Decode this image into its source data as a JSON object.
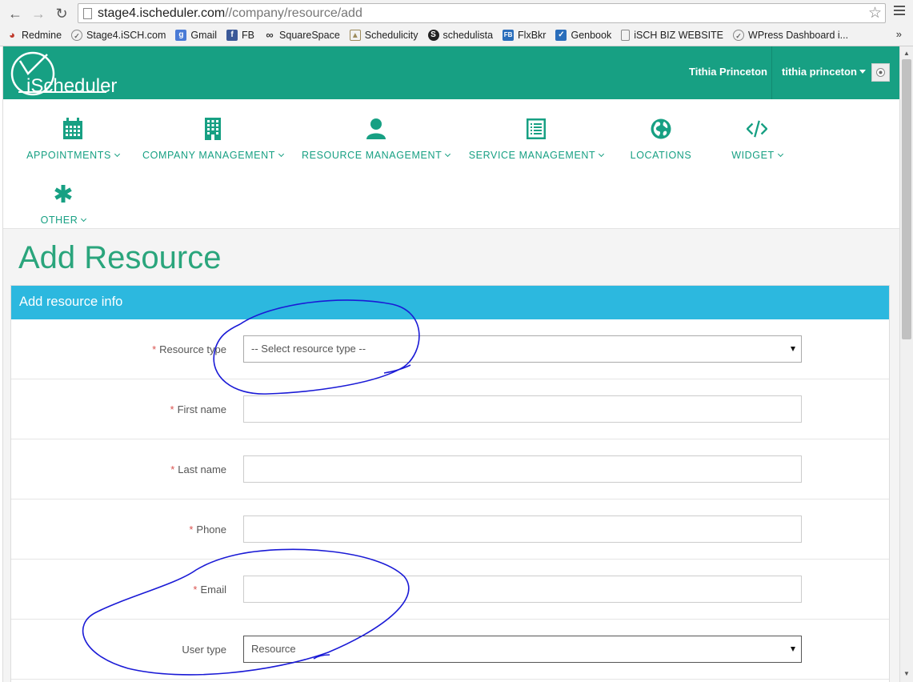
{
  "browser": {
    "url_host": "stage4.ischeduler.com",
    "url_path": "//company/resource/add",
    "bookmarks": [
      {
        "label": "Redmine",
        "icon": "redmine-icon",
        "color": "#c0392b"
      },
      {
        "label": "Stage4.iSCH.com",
        "icon": "clock-icon",
        "color": "#888888"
      },
      {
        "label": "Gmail",
        "icon": "google-icon",
        "color": "#4a7bd6"
      },
      {
        "label": "FB",
        "icon": "facebook-icon",
        "color": "#3b5998"
      },
      {
        "label": "SquareSpace",
        "icon": "squarespace-icon",
        "color": "#333333"
      },
      {
        "label": "Schedulicity",
        "icon": "schedulicity-icon",
        "color": "#9c8b5c"
      },
      {
        "label": "schedulista",
        "icon": "schedulista-icon",
        "color": "#222222"
      },
      {
        "label": "FlxBkr",
        "icon": "flxbkr-icon",
        "color": "#2a6ebb"
      },
      {
        "label": "Genbook",
        "icon": "genbook-icon",
        "color": "#2a6ebb"
      },
      {
        "label": "iSCH BIZ WEBSITE",
        "icon": "page-icon",
        "color": "#ffffff"
      },
      {
        "label": "WPress Dashboard i...",
        "icon": "clock-icon",
        "color": "#888888"
      }
    ],
    "more": "»"
  },
  "header": {
    "logo_text": "iScheduler",
    "user_display_name": "Tithia Princeton",
    "user_menu_label": "tithia princeton"
  },
  "nav": {
    "items": [
      {
        "label": "APPOINTMENTS",
        "icon": "calendar-icon"
      },
      {
        "label": "COMPANY MANAGEMENT",
        "icon": "building-icon"
      },
      {
        "label": "RESOURCE MANAGEMENT",
        "icon": "user-icon"
      },
      {
        "label": "SERVICE MANAGEMENT",
        "icon": "list-icon"
      },
      {
        "label": "LOCATIONS",
        "icon": "globe-icon"
      },
      {
        "label": "WIDGET",
        "icon": "code-icon"
      },
      {
        "label": "OTHER",
        "icon": "asterisk-icon"
      }
    ]
  },
  "page": {
    "title": "Add Resource",
    "panel_title": "Add resource info"
  },
  "form": {
    "resource_type": {
      "label": "Resource type",
      "required": "*",
      "value": "-- Select resource type --"
    },
    "first_name": {
      "label": "First name",
      "required": "*",
      "value": ""
    },
    "last_name": {
      "label": "Last name",
      "required": "*",
      "value": ""
    },
    "phone": {
      "label": "Phone",
      "required": "*",
      "value": ""
    },
    "email": {
      "label": "Email",
      "required": "*",
      "value": ""
    },
    "user_type": {
      "label": "User type",
      "value": "Resource"
    }
  },
  "colors": {
    "brand_green": "#17a083",
    "panel_blue": "#2cb8df",
    "required_red": "#d9534f",
    "annotation_ink": "#1a1ad6"
  }
}
